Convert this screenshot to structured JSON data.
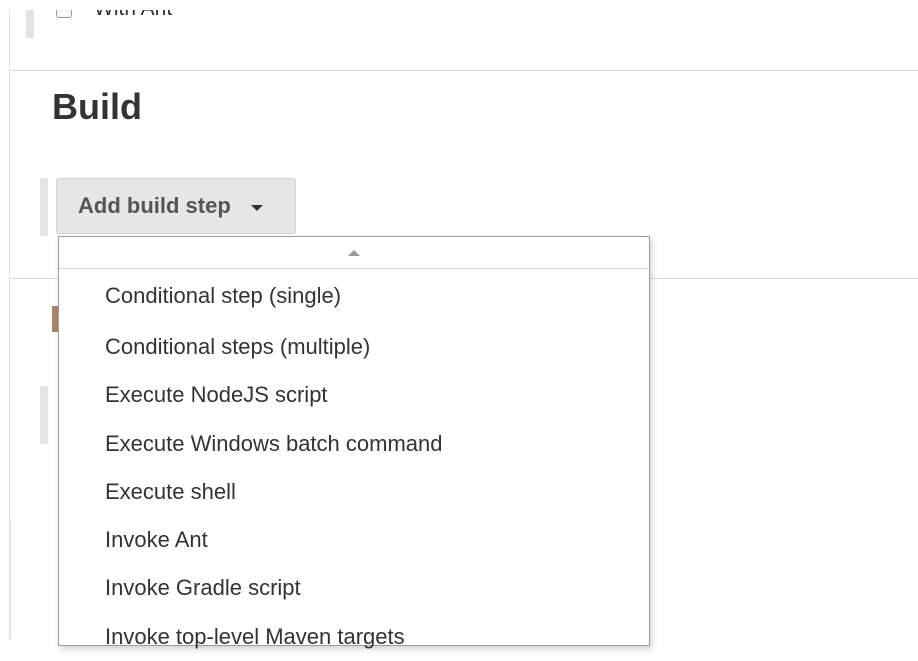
{
  "job_config": {
    "option": {
      "label": "With Ant",
      "checked": false
    },
    "build_section": {
      "title": "Build",
      "add_step_button": {
        "label": "Add build step",
        "icon": "caret-down-icon"
      },
      "step_menu": {
        "scroll_icon": "caret-up-icon",
        "items": [
          {
            "label": "Conditional step (single)"
          },
          {
            "label": "Conditional steps (multiple)"
          },
          {
            "label": "Execute NodeJS script"
          },
          {
            "label": "Execute Windows batch command"
          },
          {
            "label": "Execute shell"
          },
          {
            "label": "Invoke Ant"
          },
          {
            "label": "Invoke Gradle script"
          },
          {
            "label": "Invoke top-level Maven targets"
          }
        ]
      }
    }
  },
  "colors": {
    "text": "#333333",
    "button_bg": "#e6e6e6",
    "button_text": "#555555",
    "divider": "#dadada",
    "menu_border": "#9e9e9e"
  }
}
